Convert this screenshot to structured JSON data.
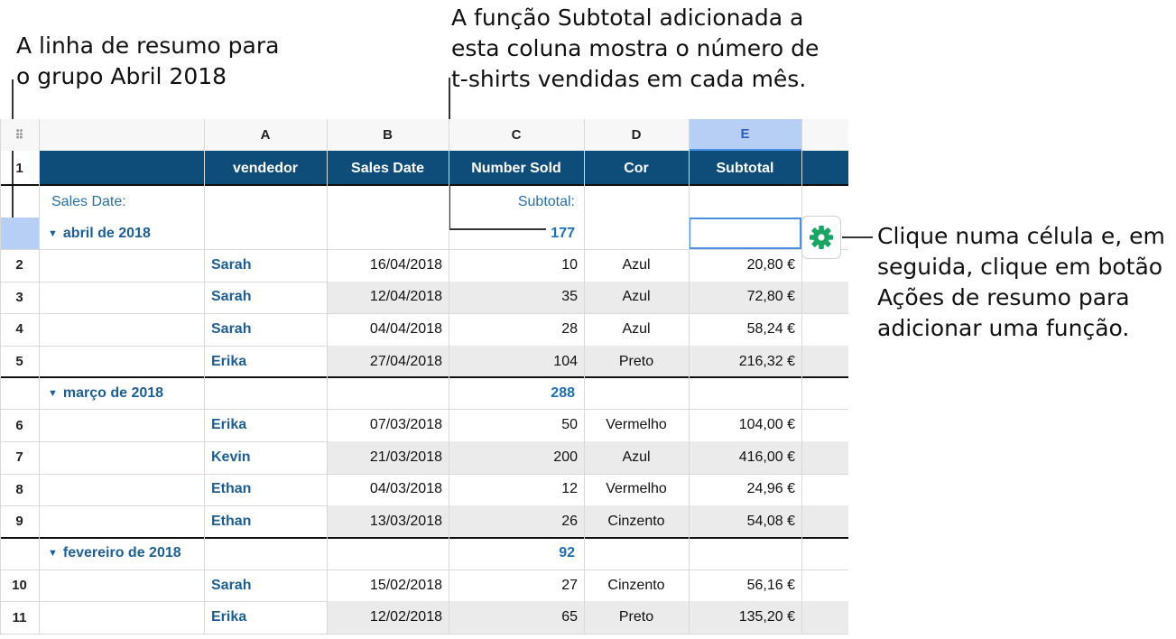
{
  "annotations": {
    "summary_row": "A linha de resumo para\no grupo Abril 2018",
    "subtotal_function": "A função Subtotal adicionada a\nesta coluna mostra o número de\nt-shirts vendidas em cada mês.",
    "actions_button": "Clique numa célula e, em\nseguida, clique em botão\nAções de resumo para\nadicionar uma função."
  },
  "column_letters": [
    "A",
    "B",
    "C",
    "D",
    "E"
  ],
  "header_row": {
    "row_number": "1",
    "labels": [
      "vendedor",
      "Sales Date",
      "Number Sold",
      "Cor",
      "Subtotal"
    ]
  },
  "summary_labels": {
    "group_by": "Sales Date:",
    "function": "Subtotal:"
  },
  "groups": [
    {
      "label": "abril de 2018",
      "subtotal": "177",
      "rows": [
        {
          "row_number": "2",
          "vendedor": "Sarah",
          "sales_date": "16/04/2018",
          "number_sold": "10",
          "cor": "Azul",
          "subtotal": "20,80 €"
        },
        {
          "row_number": "3",
          "vendedor": "Sarah",
          "sales_date": "12/04/2018",
          "number_sold": "35",
          "cor": "Azul",
          "subtotal": "72,80 €"
        },
        {
          "row_number": "4",
          "vendedor": "Sarah",
          "sales_date": "04/04/2018",
          "number_sold": "28",
          "cor": "Azul",
          "subtotal": "58,24 €"
        },
        {
          "row_number": "5",
          "vendedor": "Erika",
          "sales_date": "27/04/2018",
          "number_sold": "104",
          "cor": "Preto",
          "subtotal": "216,32 €"
        }
      ]
    },
    {
      "label": "março de 2018",
      "subtotal": "288",
      "rows": [
        {
          "row_number": "6",
          "vendedor": "Erika",
          "sales_date": "07/03/2018",
          "number_sold": "50",
          "cor": "Vermelho",
          "subtotal": "104,00 €"
        },
        {
          "row_number": "7",
          "vendedor": "Kevin",
          "sales_date": "21/03/2018",
          "number_sold": "200",
          "cor": "Azul",
          "subtotal": "416,00 €"
        },
        {
          "row_number": "8",
          "vendedor": "Ethan",
          "sales_date": "04/03/2018",
          "number_sold": "12",
          "cor": "Vermelho",
          "subtotal": "24,96 €"
        },
        {
          "row_number": "9",
          "vendedor": "Ethan",
          "sales_date": "13/03/2018",
          "number_sold": "26",
          "cor": "Cinzento",
          "subtotal": "54,08 €"
        }
      ]
    },
    {
      "label": "fevereiro de 2018",
      "subtotal": "92",
      "rows": [
        {
          "row_number": "10",
          "vendedor": "Sarah",
          "sales_date": "15/02/2018",
          "number_sold": "27",
          "cor": "Cinzento",
          "subtotal": "56,16 €"
        },
        {
          "row_number": "11",
          "vendedor": "Erika",
          "sales_date": "12/02/2018",
          "number_sold": "65",
          "cor": "Preto",
          "subtotal": "135,20 €"
        }
      ]
    }
  ],
  "icons": {
    "collapse_triangle": "▼",
    "select_all_grip": "⠿",
    "actions_button": "gear-icon"
  },
  "colors": {
    "header_fill": "#0e4c7a",
    "header_text": "#ffffff",
    "name_text": "#1d5f95",
    "subtotal_text": "#1d6fb5",
    "selected_column_fill": "#b8cff5",
    "selected_cell_border": "#4a8fe6",
    "alt_cell_fill": "#ebebeb",
    "gear_icon": "#1aa566"
  }
}
